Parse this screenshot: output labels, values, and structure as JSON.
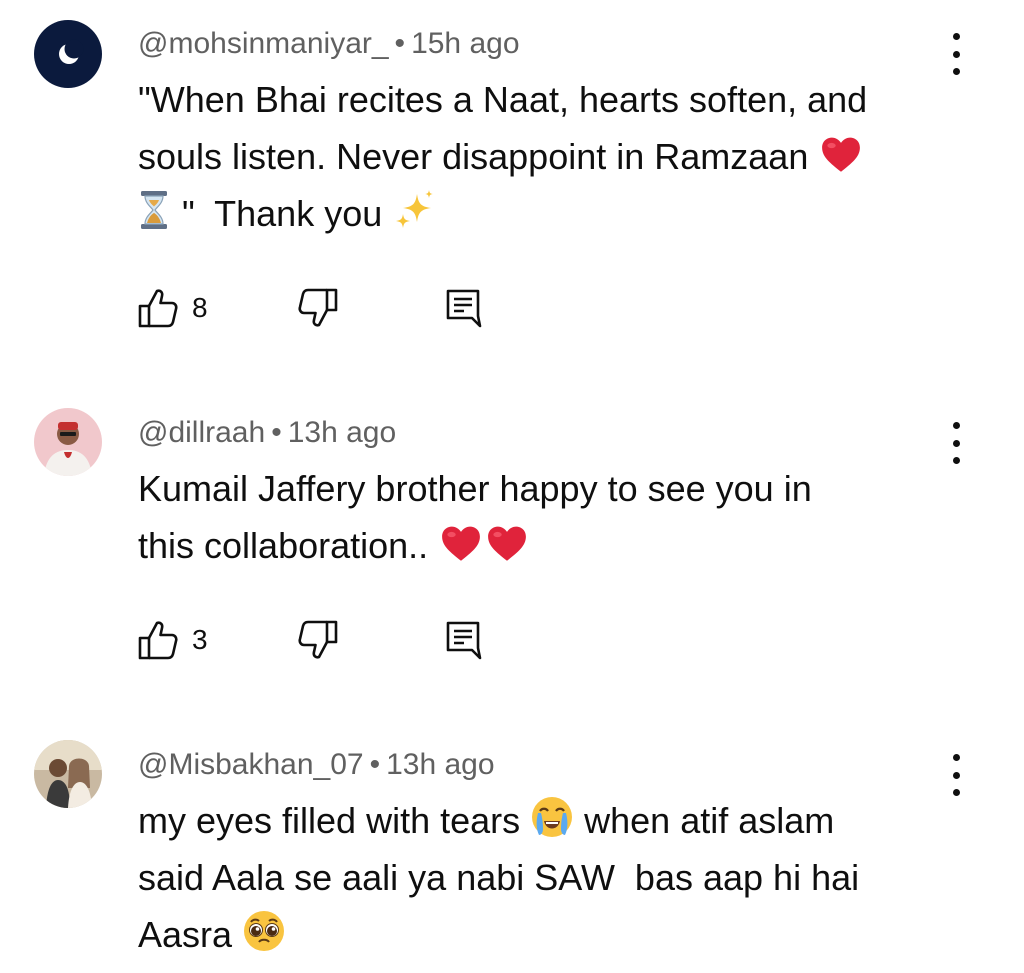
{
  "comments": [
    {
      "author": "@mohsinmaniyar_",
      "separator": "•",
      "time": "15h ago",
      "text_lines": [
        "\"When Bhai recites a Naat, hearts soften, and",
        "souls listen. Never disappoint in Ramzaan ",
        " \"  Thank you "
      ],
      "emojis": [
        "red-heart",
        "hourglass",
        "sparkles"
      ],
      "likes": "8",
      "avatar": "crescent-moon-on-navy"
    },
    {
      "author": "@dillraah",
      "separator": "•",
      "time": "13h ago",
      "text_lines": [
        "Kumail Jaffery brother happy to see you in",
        "this collaboration.. "
      ],
      "emojis": [
        "red-heart",
        "red-heart"
      ],
      "likes": "3",
      "avatar": "person-photo-pink"
    },
    {
      "author": "@Misbakhan_07",
      "separator": "•",
      "time": "13h ago",
      "text_lines": [
        "my eyes filled with tears ",
        " when atif aslam",
        "said Aala se aali ya nabi SAW  bas aap hi hai",
        "Aasra "
      ],
      "emojis": [
        "loudly-crying-face",
        "pleading-face"
      ],
      "avatar": "two-people-photo"
    }
  ],
  "icons": {
    "like": "thumbs-up-icon",
    "dislike": "thumbs-down-icon",
    "reply": "comment-reply-icon",
    "more": "more-vertical-icon"
  },
  "colors": {
    "text": "#0f0f0f",
    "meta": "#606060",
    "heart": "#e0233b",
    "avatar_moon_bg": "#0b1a3d"
  }
}
